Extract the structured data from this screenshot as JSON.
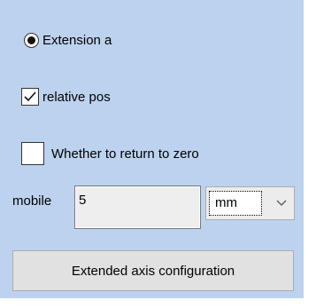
{
  "options": {
    "radio_label": "Extension a",
    "checkbox_relative_label": "relative pos",
    "checkbox_zero_label": "Whether to return to zero"
  },
  "move": {
    "label": "mobile",
    "value": "5",
    "unit_selected": "mm"
  },
  "buttons": {
    "extended_axis_label": "Extended axis configuration"
  },
  "colors": {
    "panel_bg": "#bcd2ee"
  },
  "icons": {
    "checkmark": "check-icon",
    "dropdown": "chevron-down-icon"
  }
}
